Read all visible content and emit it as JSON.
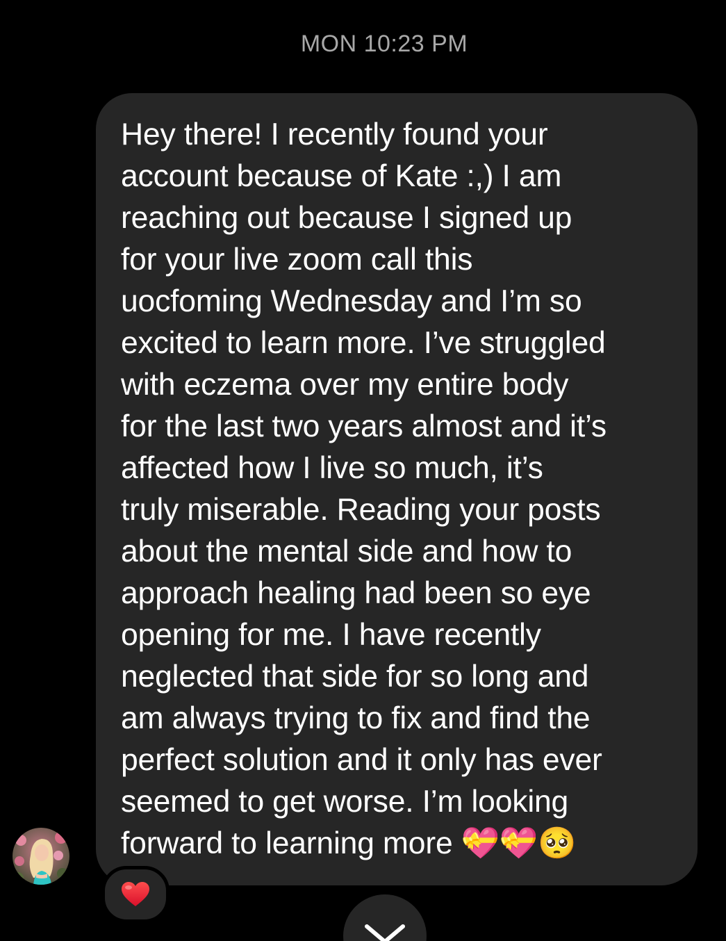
{
  "header": {
    "timestamp": "MON 10:23 PM"
  },
  "message": {
    "text": "Hey there! I recently found your\naccount because of Kate :,) I am\nreaching out because I signed up\nfor your live zoom call this\nuocfoming Wednesday and I’m so\nexcited to learn more. I’ve struggled\nwith eczema over my entire body\nfor the last two years almost and it’s\naffected how I live so much, it’s\ntruly miserable. Reading your posts\nabout the mental side and how to\napproach healing had been so eye\nopening for me. I have recently\nneglected that side for so long and\nam always trying to fix and find the\nperfect solution and it only has ever\nseemed to get worse. I’m looking\nforward to learning more 💝💝🥺",
    "reaction_emoji": "❤️",
    "sender_avatar": "avatar-photo"
  },
  "controls": {
    "scroll_down_icon": "chevron-down-icon"
  },
  "colors": {
    "background": "#000000",
    "bubble": "#262626",
    "timestamp": "#a8a8a8",
    "text": "#ffffff",
    "reaction": "#e0245e"
  }
}
